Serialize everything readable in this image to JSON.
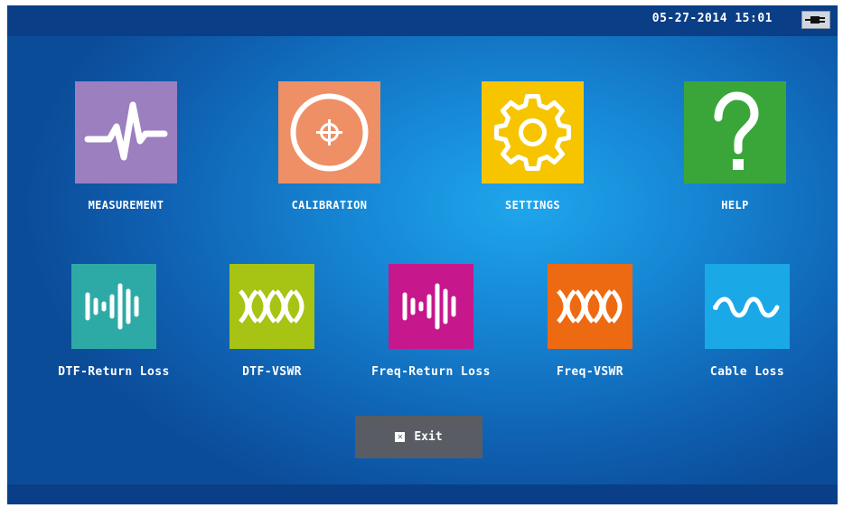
{
  "status_bar": {
    "datetime": "05-27-2014 15:01",
    "power_icon": "plug-icon"
  },
  "main_menu": [
    {
      "label": "MEASUREMENT",
      "icon": "waveform-icon",
      "color": "#9b7fbf"
    },
    {
      "label": "CALIBRATION",
      "icon": "crosshair-icon",
      "color": "#ee8f66"
    },
    {
      "label": "SETTINGS",
      "icon": "gear-icon",
      "color": "#f7c500"
    },
    {
      "label": "HELP",
      "icon": "question-icon",
      "color": "#3aa63a"
    }
  ],
  "modes": [
    {
      "label": "DTF-Return Loss",
      "icon": "return-loss-icon",
      "color": "#2eaaa6"
    },
    {
      "label": "DTF-VSWR",
      "icon": "vswr-icon",
      "color": "#a7c313"
    },
    {
      "label": "Freq-Return Loss",
      "icon": "return-loss-icon",
      "color": "#c6178c"
    },
    {
      "label": "Freq-VSWR",
      "icon": "vswr-icon",
      "color": "#ee6a12"
    },
    {
      "label": "Cable Loss",
      "icon": "sine-wave-icon",
      "color": "#1aa9e6"
    }
  ],
  "exit": {
    "label": "Exit",
    "icon": "close-box-icon"
  }
}
